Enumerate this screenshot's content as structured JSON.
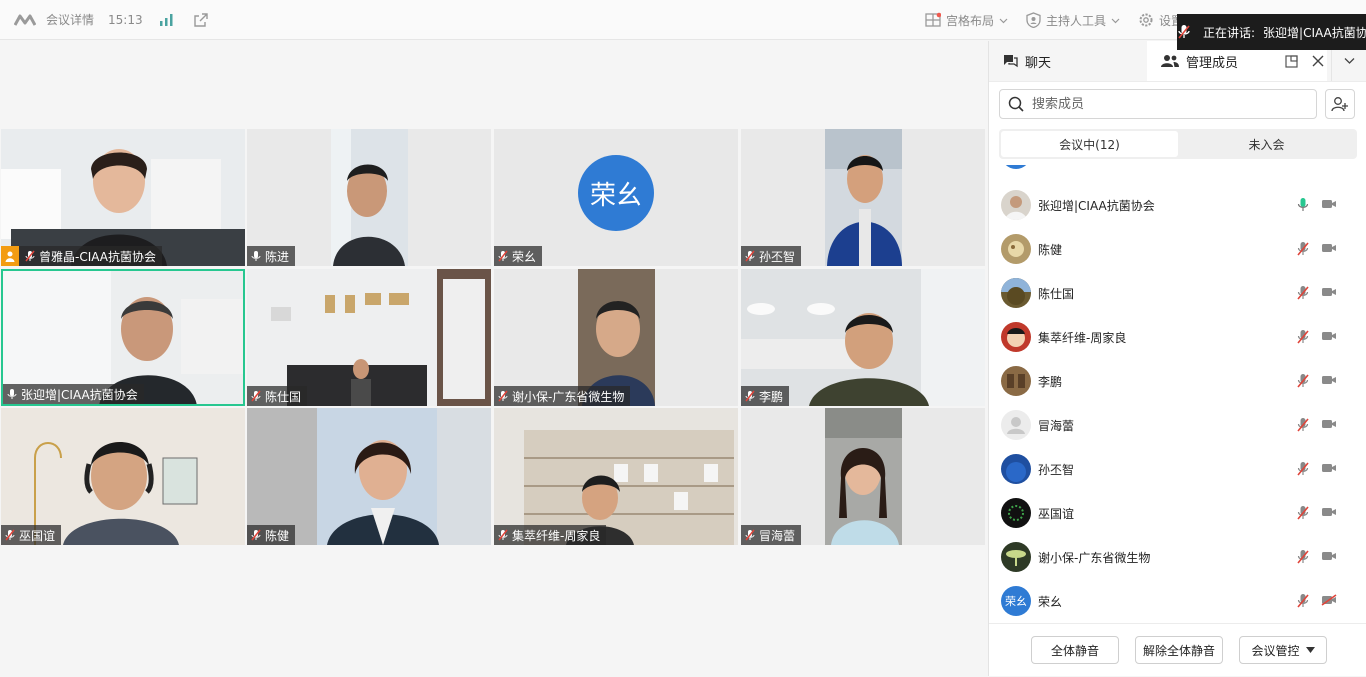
{
  "topbar": {
    "meeting_details": "会议详情",
    "time": "15:13",
    "layout_label": "宫格布局",
    "host_tools_label": "主持人工具",
    "settings_label": "设置"
  },
  "speaking": {
    "prefix": "正在讲话:",
    "name": "张迎增|CIAA抗菌协会"
  },
  "tiles": [
    {
      "name": "曾雅晶-CIAA抗菌协会",
      "mic": "muted",
      "host": true
    },
    {
      "name": "陈进",
      "mic": "on"
    },
    {
      "name": "荣幺",
      "mic": "muted",
      "avatar_text": "荣幺"
    },
    {
      "name": "孙丕智",
      "mic": "muted"
    },
    {
      "name": "张迎增|CIAA抗菌协会",
      "mic": "on",
      "active": true
    },
    {
      "name": "陈仕国",
      "mic": "muted"
    },
    {
      "name": "谢小保-广东省微生物",
      "mic": "muted"
    },
    {
      "name": "李鹏",
      "mic": "muted"
    },
    {
      "name": "巫国谊",
      "mic": "muted"
    },
    {
      "name": "陈健",
      "mic": "muted"
    },
    {
      "name": "集萃纤维-周家良",
      "mic": "muted"
    },
    {
      "name": "冒海蕾",
      "mic": "muted"
    }
  ],
  "panel": {
    "tab_chat": "聊天",
    "tab_members": "管理成员",
    "search_placeholder": "搜索成员",
    "seg_in_meeting": "会议中(12)",
    "seg_not_joined": "未入会",
    "members": [
      {
        "name": "张迎增|CIAA抗菌协会",
        "mic": "active",
        "cam": "on",
        "avatar_color": "#c9c2b8"
      },
      {
        "name": "陈健",
        "mic": "muted",
        "cam": "on",
        "avatar_color": "#b39b6a"
      },
      {
        "name": "陈仕国",
        "mic": "muted",
        "cam": "on",
        "avatar_color": "#7a6a3a"
      },
      {
        "name": "集萃纤维-周家良",
        "mic": "muted",
        "cam": "on",
        "avatar_color": "#c0392b"
      },
      {
        "name": "李鹏",
        "mic": "muted",
        "cam": "on",
        "avatar_color": "#8a6a45"
      },
      {
        "name": "冒海蕾",
        "mic": "muted",
        "cam": "on",
        "avatar_color": "#e6e6e6"
      },
      {
        "name": "孙丕智",
        "mic": "muted",
        "cam": "on",
        "avatar_color": "#1f4fa0"
      },
      {
        "name": "巫国谊",
        "mic": "muted",
        "cam": "on",
        "avatar_color": "#1a2a1a"
      },
      {
        "name": "谢小保-广东省微生物",
        "mic": "muted",
        "cam": "on",
        "avatar_color": "#5a7a3a"
      },
      {
        "name": "荣幺",
        "mic": "muted",
        "cam": "off",
        "avatar_color": "#2f7bd4",
        "avatar_text": "荣幺"
      }
    ],
    "btn_mute_all": "全体静音",
    "btn_unmute_all": "解除全体静音",
    "btn_meeting_control": "会议管控"
  },
  "colors": {
    "accent_green": "#27c790",
    "mute_red": "#e0443a",
    "avatar_blue": "#2f7bd4",
    "host_orange": "#f39c12"
  }
}
